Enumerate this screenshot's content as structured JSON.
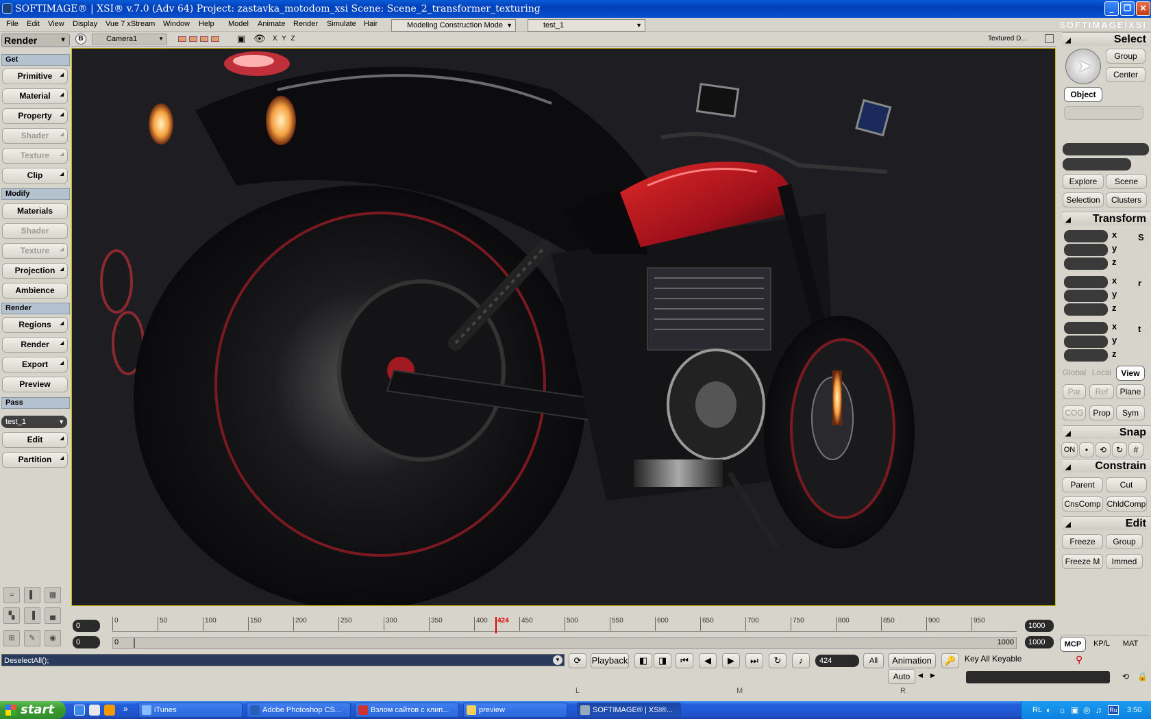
{
  "window": {
    "title": "SOFTIMAGE® | XSI® v.7.0 (Adv 64) Project: zastavka_motodom_xsi    Scene: Scene_2_transformer_texturing"
  },
  "menu": {
    "items": [
      "File",
      "Edit",
      "View",
      "Display",
      "Vue 7 xStream",
      "Window",
      "Help",
      "Model",
      "Animate",
      "Render",
      "Simulate",
      "Hair"
    ],
    "mode": "Modeling Construction Mode",
    "pass": "test_1",
    "brand": "SOFTIMAGE|XSI"
  },
  "left_panel": {
    "module": "Render",
    "sections": {
      "get": "Get",
      "modify": "Modify",
      "render": "Render",
      "pass": "Pass"
    },
    "get_buttons": [
      "Primitive",
      "Material",
      "Property",
      "Shader",
      "Texture",
      "Clip"
    ],
    "modify_buttons": [
      "Materials",
      "Shader",
      "Texture",
      "Projection",
      "Ambience"
    ],
    "render_buttons": [
      "Regions",
      "Render",
      "Export",
      "Preview"
    ],
    "pass_value": "test_1",
    "pass_buttons": [
      "Edit",
      "Partition"
    ]
  },
  "viewport": {
    "letter": "B",
    "camera": "Camera1",
    "axes": "X Y Z",
    "display_mode": "Textured D..."
  },
  "timeline": {
    "start": "0",
    "end": "1000",
    "end2": "1000",
    "range_start": "0",
    "range_start2": "0",
    "range_end": "1000",
    "current_frame": "424",
    "ticks": [
      "0",
      "50",
      "100",
      "150",
      "200",
      "250",
      "300",
      "350",
      "400",
      "450",
      "500",
      "550",
      "600",
      "650",
      "700",
      "750",
      "800",
      "850",
      "900",
      "950"
    ]
  },
  "right_panel": {
    "select_header": "Select",
    "group": "Group",
    "center": "Center",
    "object": "Object",
    "explore": "Explore",
    "scene": "Scene",
    "selection": "Selection",
    "clusters": "Clusters",
    "transform_header": "Transform",
    "xyz": [
      "x",
      "y",
      "z"
    ],
    "srt": [
      "S",
      "r",
      "t"
    ],
    "global": "Global",
    "local": "Local",
    "view": "View",
    "par": "Par",
    "ref": "Ref",
    "plane": "Plane",
    "cog": "COG",
    "prop": "Prop",
    "sym": "Sym",
    "snap_header": "Snap",
    "snap_on": "ON",
    "constrain_header": "Constrain",
    "parent": "Parent",
    "cut": "Cut",
    "cnscomp": "CnsComp",
    "chldcomp": "ChldComp",
    "edit_header": "Edit",
    "freeze": "Freeze",
    "edit_group": "Group",
    "freeze_m": "Freeze M",
    "immed": "Immed",
    "tabs": [
      "MCP",
      "KP/L",
      "MAT"
    ]
  },
  "command": {
    "script": "DeselectAll();",
    "playback": "Playback",
    "frame": "424",
    "all": "All",
    "animation": "Animation",
    "auto": "Auto",
    "key_all": "Key All Keyable",
    "mouse_l": "L",
    "mouse_m": "M",
    "mouse_r": "R"
  },
  "taskbar": {
    "start": "start",
    "tasks": [
      "iTunes",
      "Adobe Photoshop CS...",
      "Взлом сайтов с клип...",
      "preview",
      "SOFTIMAGE® | XSI®..."
    ],
    "lang": "RL",
    "lang2": "Ru",
    "time": "3:50"
  },
  "colors": {
    "accent": "#0a4fd0",
    "section": "#b4c2cf",
    "viewport_bg": "#1e1e22",
    "bike_red": "#b0101a"
  }
}
